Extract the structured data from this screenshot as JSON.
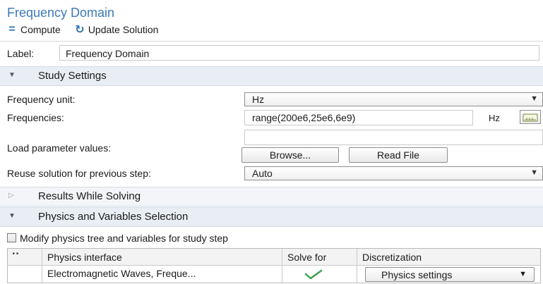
{
  "header": {
    "title": "Frequency Domain",
    "compute_label": "Compute",
    "update_label": "Update Solution"
  },
  "label_row": {
    "label": "Label:",
    "value": "Frequency Domain"
  },
  "sections": {
    "study_settings": "Study Settings",
    "results_while_solving": "Results While Solving",
    "physics_variables": "Physics and Variables Selection"
  },
  "study_settings": {
    "frequency_unit_label": "Frequency unit:",
    "frequency_unit_value": "Hz",
    "frequencies_label": "Frequencies:",
    "frequencies_value": "range(200e6,25e6,6e9)",
    "frequencies_unit": "Hz",
    "load_params_label": "Load parameter values:",
    "load_params_value": "",
    "browse_label": "Browse...",
    "read_file_label": "Read File",
    "reuse_label": "Reuse solution for previous step:",
    "reuse_value": "Auto"
  },
  "physics": {
    "modify_label": "Modify physics tree and variables for study step",
    "modify_checked": false,
    "table": {
      "columns": [
        "Physics interface",
        "Solve for",
        "Discretization"
      ],
      "rows": [
        {
          "interface": "Electromagnetic Waves, Freque...",
          "solve_for": true,
          "discretization": "Physics settings"
        }
      ]
    }
  },
  "colors": {
    "title": "#3c79b8",
    "section_bg": "#e9eef4",
    "check": "#3aa04a"
  }
}
